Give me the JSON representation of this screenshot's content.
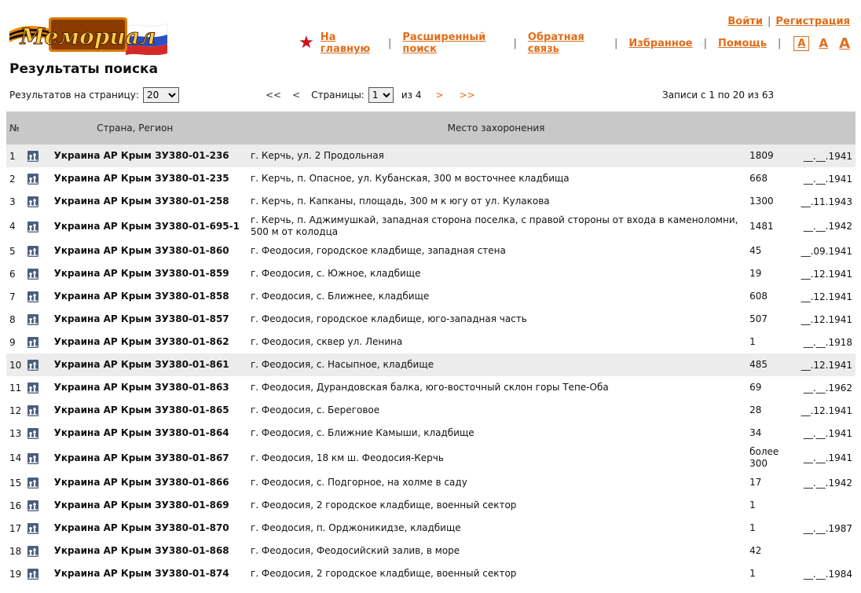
{
  "logo": {
    "text": "Мемориал"
  },
  "auth": {
    "login": "Войти",
    "register": "Регистрация"
  },
  "nav": {
    "home": "На главную",
    "advanced_search": "Расширенный поиск",
    "feedback": "Обратная связь",
    "favorites": "Избранное",
    "help": "Помощь",
    "font_sizes": [
      "A",
      "A",
      "A"
    ]
  },
  "page_title": "Результаты поиска",
  "controls": {
    "per_page_label": "Результатов на страницу:",
    "per_page_value": "20",
    "first": "<<",
    "prev": "<",
    "pages_label": "Страницы:",
    "page_value": "1",
    "of_label": "из 4",
    "next": ">",
    "last": ">>",
    "records_text": "Записи с 1 по 20 из 63"
  },
  "table": {
    "headers": {
      "num": "№",
      "region": "Страна, Регион",
      "place": "Место захоронения"
    },
    "rows": [
      {
        "num": "1",
        "region": "Украина АР Крым ЗУ380-01-236",
        "place": "г. Керчь, ул. 2 Продольная",
        "count": "1809",
        "date": "__.__.1941",
        "highlight": true
      },
      {
        "num": "2",
        "region": "Украина АР Крым ЗУ380-01-235",
        "place": "г. Керчь, п. Опасное, ул. Кубанская, 300 м восточнее кладбища",
        "count": "668",
        "date": "__.__.1941",
        "highlight": false
      },
      {
        "num": "3",
        "region": "Украина АР Крым ЗУ380-01-258",
        "place": "г. Керчь, п. Капканы, площадь, 300 м к югу от ул. Кулакова",
        "count": "1300",
        "date": "__.11.1943",
        "highlight": false
      },
      {
        "num": "4",
        "region": "Украина АР Крым ЗУ380-01-695-1",
        "place": "г. Керчь, п. Аджимушкай, западная сторона поселка, с правой стороны от входа в каменоломни, 500 м от колодца",
        "count": "1481",
        "date": "__.__.1942",
        "highlight": false
      },
      {
        "num": "5",
        "region": "Украина АР Крым ЗУ380-01-860",
        "place": "г. Феодосия, городское кладбище, западная стена",
        "count": "45",
        "date": "__.09.1941",
        "highlight": false
      },
      {
        "num": "6",
        "region": "Украина АР Крым ЗУ380-01-859",
        "place": "г. Феодосия, с. Южное, кладбище",
        "count": "19",
        "date": "__.12.1941",
        "highlight": false
      },
      {
        "num": "7",
        "region": "Украина АР Крым ЗУ380-01-858",
        "place": "г. Феодосия, с. Ближнее, кладбище",
        "count": "608",
        "date": "__.12.1941",
        "highlight": false
      },
      {
        "num": "8",
        "region": "Украина АР Крым ЗУ380-01-857",
        "place": "г. Феодосия, городское кладбище, юго-западная часть",
        "count": "507",
        "date": "__.12.1941",
        "highlight": false
      },
      {
        "num": "9",
        "region": "Украина АР Крым ЗУ380-01-862",
        "place": "г. Феодосия, сквер ул. Ленина",
        "count": "1",
        "date": "__.__.1918",
        "highlight": false
      },
      {
        "num": "10",
        "region": "Украина АР Крым ЗУ380-01-861",
        "place": "г. Феодосия, с. Насыпное, кладбище",
        "count": "485",
        "date": "__.12.1941",
        "highlight": true
      },
      {
        "num": "11",
        "region": "Украина АР Крым ЗУ380-01-863",
        "place": "г. Феодосия, Дурандовская балка, юго-восточный склон горы Тепе-Оба",
        "count": "69",
        "date": "__.__.1962",
        "highlight": false
      },
      {
        "num": "12",
        "region": "Украина АР Крым ЗУ380-01-865",
        "place": "г. Феодосия, с. Береговое",
        "count": "28",
        "date": "__.12.1941",
        "highlight": false
      },
      {
        "num": "13",
        "region": "Украина АР Крым ЗУ380-01-864",
        "place": "г. Феодосия, с. Ближние Камыши, кладбище",
        "count": "34",
        "date": "__.__.1941",
        "highlight": false
      },
      {
        "num": "14",
        "region": "Украина АР Крым ЗУ380-01-867",
        "place": "г. Феодосия, 18 км ш. Феодосия-Керчь",
        "count": "более 300",
        "date": "__.__.1941",
        "highlight": false
      },
      {
        "num": "15",
        "region": "Украина АР Крым ЗУ380-01-866",
        "place": "г. Феодосия, с. Подгорное, на холме в саду",
        "count": "17",
        "date": "__.__.1942",
        "highlight": false
      },
      {
        "num": "16",
        "region": "Украина АР Крым ЗУ380-01-869",
        "place": "г. Феодосия, 2 городское кладбище, военный сектор",
        "count": "1",
        "date": "",
        "highlight": false
      },
      {
        "num": "17",
        "region": "Украина АР Крым ЗУ380-01-870",
        "place": "г. Феодосия, п. Орджоникидзе, кладбище",
        "count": "1",
        "date": "__.__.1987",
        "highlight": false
      },
      {
        "num": "18",
        "region": "Украина АР Крым ЗУ380-01-868",
        "place": "г. Феодосия, Феодосийский залив, в море",
        "count": "42",
        "date": "",
        "highlight": false
      },
      {
        "num": "19",
        "region": "Украина АР Крым ЗУ380-01-874",
        "place": "г. Феодосия, 2 городское кладбище, военный сектор",
        "count": "1",
        "date": "__.__.1984",
        "highlight": false
      }
    ]
  },
  "colors": {
    "link": "#e06d1a",
    "header_bg": "#c8c8c8",
    "row_highlight": "#ececec",
    "star": "#d0121b",
    "icon": "#4a5f80"
  },
  "icons": {
    "row_icon": "memorial-icon",
    "nav_star": "star-icon"
  }
}
